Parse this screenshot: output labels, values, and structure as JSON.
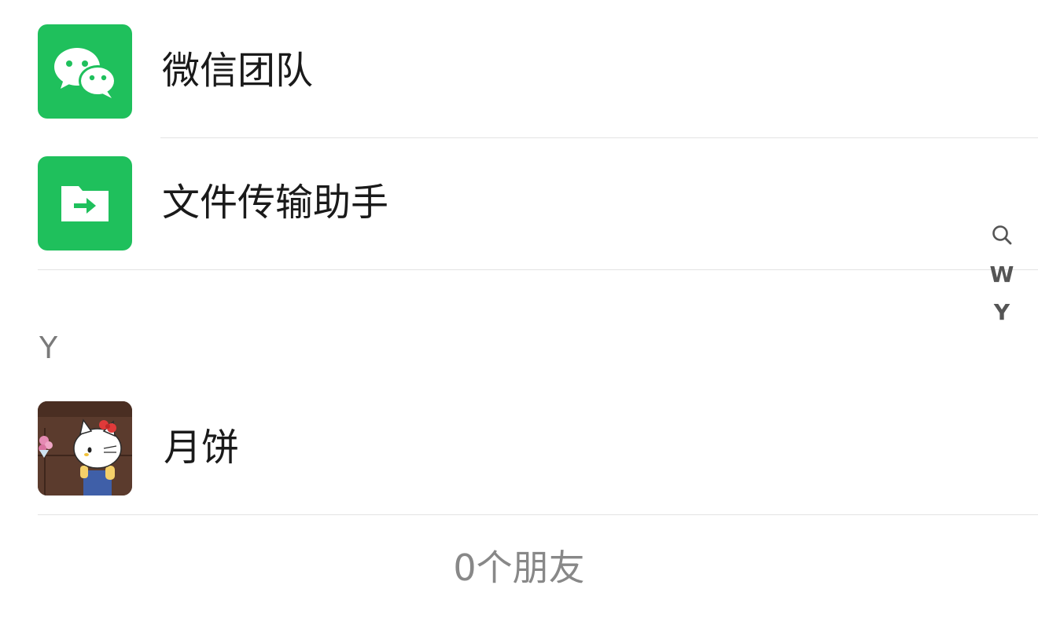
{
  "contacts": {
    "official": [
      {
        "name": "微信团队",
        "icon": "wechat-logo-icon"
      },
      {
        "name": "文件传输助手",
        "icon": "file-transfer-icon"
      }
    ],
    "sections": [
      {
        "letter": "Y",
        "items": [
          {
            "name": "月饼",
            "icon": "hello-kitty-avatar"
          }
        ]
      }
    ]
  },
  "index_bar": {
    "items": [
      {
        "label": "",
        "icon": "search-icon"
      },
      {
        "label": "W"
      },
      {
        "label": "Y"
      }
    ]
  },
  "footer": {
    "count_text": "0个朋友"
  },
  "colors": {
    "wechat_green": "#1fc05c",
    "divider": "#e3e3e3",
    "name_text": "#1a1a1a",
    "section_text": "#7a7a7a",
    "index_text": "#555555"
  }
}
